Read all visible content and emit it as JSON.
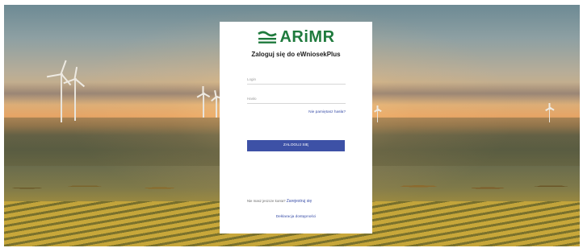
{
  "brand": {
    "name": "ARiMR",
    "logo_icon": "arimr-wave-logo-icon",
    "color": "#1f7a3d"
  },
  "login": {
    "title": "Zaloguj się do eWniosekPlus",
    "username_placeholder": "Login",
    "password_placeholder": "Hasło",
    "forgot_password": "Nie pamiętasz hasła?",
    "submit_label": "ZALOGUJ SIĘ",
    "button_color": "#3d51a6"
  },
  "footer": {
    "no_account_text": "Nie masz jeszcze konta?",
    "register_label": "Zarejestruj się",
    "accessibility_label": "Deklaracja dostępności"
  },
  "background": {
    "description_icon": "landscape-wind-turbines-image"
  }
}
